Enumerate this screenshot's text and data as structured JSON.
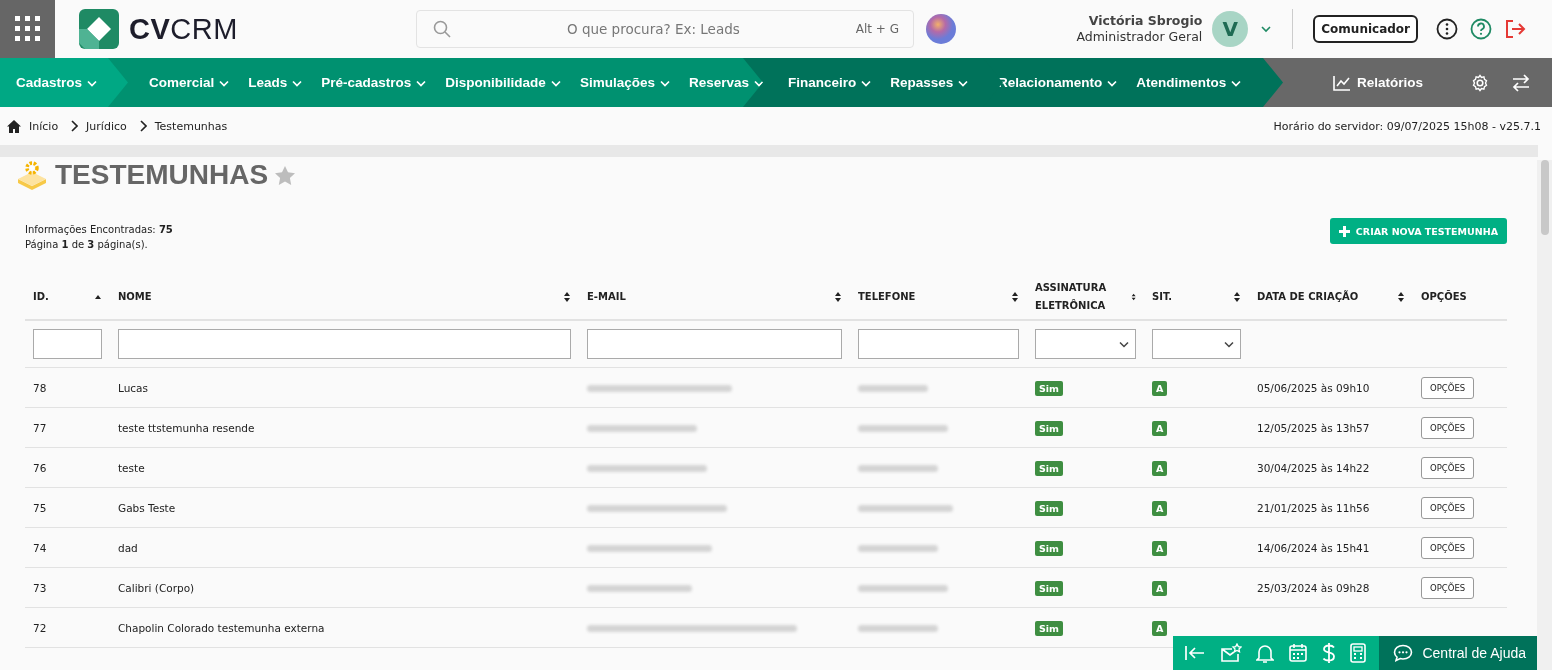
{
  "header": {
    "logo": {
      "bold": "CV",
      "light": "CRM"
    },
    "search": {
      "placeholder": "O que procura? Ex: Leads",
      "shortcut": "Alt + G"
    },
    "user": {
      "name": "Victória Sbrogio",
      "role": "Administrador Geral",
      "initial": "V"
    },
    "button": "Comunicador"
  },
  "nav": [
    {
      "kind": "start",
      "color": "#00a884",
      "items": [
        "Cadastros"
      ]
    },
    {
      "kind": "menu",
      "color": "#009170",
      "items": [
        "Comercial",
        "Leads",
        "Pré-cadastros",
        "Disponibilidade",
        "Simulações",
        "Reservas"
      ]
    },
    {
      "kind": "menu",
      "color": "#00725a",
      "items": [
        "Financeiro",
        "Repasses"
      ]
    },
    {
      "kind": "menu",
      "color": "#00725a",
      "items": [
        "Relacionamento",
        "Atendimentos"
      ]
    },
    {
      "kind": "tools",
      "color": "#686868",
      "items": [
        "Relatórios"
      ]
    }
  ],
  "breadcrumb": [
    "Início",
    "Jurídico",
    "Testemunhas"
  ],
  "server_time": "Horário do servidor: 09/07/2025 15h08 - v25.7.1",
  "title": "TESTEMUNHAS",
  "favorite": false,
  "info": [
    "Informações Encontradas: **75**",
    "Página **1** de **3** página(s)."
  ],
  "create_button": "CRIAR NOVA TESTEMUNHA",
  "table": {
    "columns": [
      {
        "label": "ID.",
        "sortable": true,
        "sorted": true,
        "kind": "text"
      },
      {
        "label": "NOME",
        "sortable": true,
        "sorted": false,
        "kind": "text"
      },
      {
        "label": "E-MAIL",
        "sortable": true,
        "sorted": false,
        "kind": "text"
      },
      {
        "label": "TELEFONE",
        "sortable": true,
        "sorted": false,
        "kind": "text"
      },
      {
        "label": "ASSINATURA ELETRÔNICA",
        "sortable": true,
        "sorted": false,
        "kind": "select"
      },
      {
        "label": "SIT.",
        "sortable": true,
        "sorted": false,
        "kind": "select"
      },
      {
        "label": "DATA DE CRIAÇÃO",
        "sortable": true,
        "sorted": false,
        "kind": "plain"
      },
      {
        "label": "OPÇÕES",
        "kind": "plain"
      }
    ],
    "rows": [
      {
        "id": "78",
        "name": "Lucas",
        "signature": "Sim",
        "status": "A",
        "created": "05/06/2025 às 09h10",
        "options": "OPÇÕES"
      },
      {
        "id": "77",
        "name": "teste ttstemunha resende",
        "signature": "Sim",
        "status": "A",
        "created": "12/05/2025 às 13h57",
        "options": "OPÇÕES"
      },
      {
        "id": "76",
        "name": "teste",
        "signature": "Sim",
        "status": "A",
        "created": "30/04/2025 às 14h22",
        "options": "OPÇÕES"
      },
      {
        "id": "75",
        "name": "Gabs Teste",
        "signature": "Sim",
        "status": "A",
        "created": "21/01/2025 às 11h56",
        "options": "OPÇÕES"
      },
      {
        "id": "74",
        "name": "dad",
        "signature": "Sim",
        "status": "A",
        "created": "14/06/2024 às 15h41",
        "options": "OPÇÕES"
      },
      {
        "id": "73",
        "name": "Calibri (Corpo)",
        "signature": "Sim",
        "status": "A",
        "created": "25/03/2024 às 09h28",
        "options": "OPÇÕES"
      },
      {
        "id": "72",
        "name": "Chapolin Colorado testemunha externa",
        "signature": "Sim",
        "status": "A"
      }
    ]
  },
  "help_bar": {
    "label": "Central de Ajuda"
  }
}
